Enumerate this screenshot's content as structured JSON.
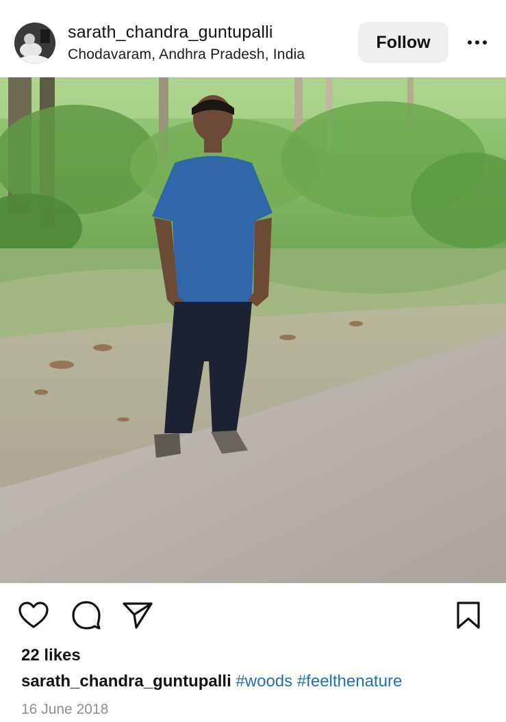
{
  "post": {
    "username": "sarath_chandra_guntupalli",
    "location": "Chodavaram, Andhra Pradesh, India",
    "follow_label": "Follow",
    "likes": "22 likes",
    "caption_user": "sarath_chandra_guntupalli",
    "hashtags": [
      "#woods",
      "#feelthenature"
    ],
    "date": "16 June 2018"
  },
  "icons": {
    "more": "more-horizontal-icon",
    "like": "heart-icon",
    "comment": "comment-bubble-icon",
    "share": "paper-plane-icon",
    "save": "bookmark-icon"
  },
  "colors": {
    "hashtag": "#1f6fb8",
    "follow_bg": "#efefef",
    "date": "#8e8e8e"
  }
}
